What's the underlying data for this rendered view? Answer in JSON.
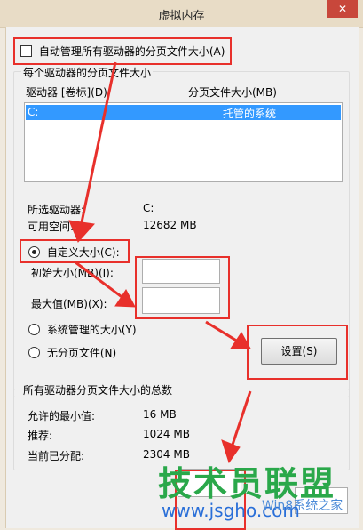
{
  "window": {
    "title": "虚拟内存",
    "close_symbol": "✕"
  },
  "auto_manage": {
    "label": "自动管理所有驱动器的分页文件大小(A)",
    "checked": false
  },
  "per_drive": {
    "group_title": "每个驱动器的分页文件大小",
    "col_drive": "驱动器 [卷标](D)",
    "col_size": "分页文件大小(MB)",
    "rows": [
      {
        "drive": "C:",
        "size": "托管的系统"
      }
    ],
    "selected_drive_label": "所选驱动器:",
    "selected_drive_value": "C:",
    "free_space_label": "可用空间:",
    "free_space_value": "12682 MB",
    "custom_size_label": "自定义大小(C):",
    "initial_size_label": "初始大小(MB)(I):",
    "initial_size_value": "",
    "max_size_label": "最大值(MB)(X):",
    "max_size_value": "",
    "system_managed_label": "系统管理的大小(Y)",
    "no_paging_label": "无分页文件(N)",
    "set_button": "设置(S)"
  },
  "totals": {
    "group_title": "所有驱动器分页文件大小的总数",
    "min_label": "允许的最小值:",
    "min_value": "16 MB",
    "recommended_label": "推荐:",
    "recommended_value": "1024 MB",
    "current_label": "当前已分配:",
    "current_value": "2304 MB"
  },
  "watermark": {
    "text": "技术员联盟",
    "url": "www.jsgho.com",
    "brand": "Win8系统之家"
  }
}
